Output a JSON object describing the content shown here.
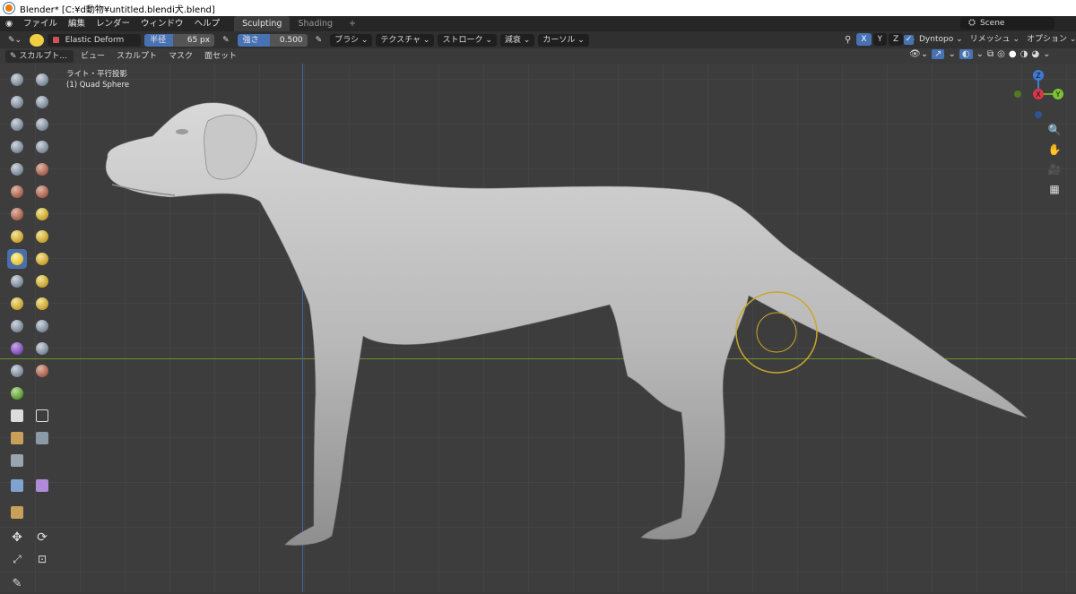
{
  "window": {
    "title": "Blender* [C:¥d動物¥untitled.blendi犬.blend]"
  },
  "menu": {
    "items": [
      "ファイル",
      "編集",
      "レンダー",
      "ウィンドウ",
      "ヘルプ"
    ],
    "tabs": [
      "Sculpting",
      "Shading"
    ],
    "add_tab": "+",
    "scene": "Scene"
  },
  "tool_header": {
    "brush_name": "Elastic Deform",
    "radius_label": "半径",
    "radius_value": "65 px",
    "strength_label": "強さ",
    "strength_value": "0.500",
    "menus": [
      "ブラシ",
      "テクスチャ",
      "ストローク",
      "減衰",
      "カーソル"
    ],
    "axes": [
      "X",
      "Y",
      "Z"
    ],
    "dyntopo": "Dyntopo",
    "remesh": "リメッシュ",
    "options": "オプション"
  },
  "view_header": {
    "mode": "スカルプト...",
    "menus": [
      "ビュー",
      "スカルプト",
      "マスク",
      "面セット"
    ]
  },
  "viewport": {
    "info_line1": "ライト・平行投影",
    "info_line2": "(1) Quad Sphere",
    "gizmo": {
      "z": "Z",
      "x": "X",
      "y": "Y"
    }
  },
  "colors": {
    "accent": "#4772b3",
    "brush_circle": "#c8a82a",
    "x_axis": "#6d8f2a",
    "y_axis": "#3f67a5"
  }
}
